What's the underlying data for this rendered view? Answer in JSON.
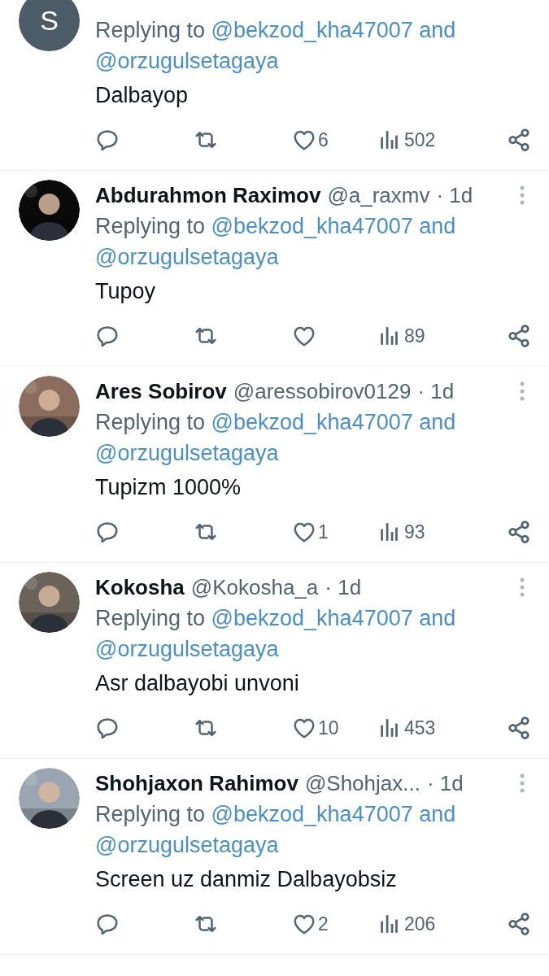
{
  "replies": [
    {
      "avatar": {
        "kind": "letter",
        "letter": "S"
      },
      "replying_label": "Replying to",
      "mentions": [
        "@bekzod_kha47007 and",
        "@orzugulsetagaya"
      ],
      "text": "Dalbayop",
      "actions": {
        "likes": "6",
        "views": "502"
      }
    },
    {
      "author": {
        "name": "Abdurahmon Raximov",
        "handle": "@a_raxmv",
        "time": "· 1d"
      },
      "replying_label": "Replying to",
      "mentions": [
        "@bekzod_kha47007 and",
        "@orzugulsetagaya"
      ],
      "text": "Tupoy",
      "actions": {
        "views": "89"
      }
    },
    {
      "author": {
        "name": "Ares Sobirov",
        "handle": "@aressobirov0129",
        "time": "· 1d"
      },
      "replying_label": "Replying to",
      "mentions": [
        "@bekzod_kha47007 and",
        "@orzugulsetagaya"
      ],
      "text": "Tupizm 1000%",
      "actions": {
        "likes": "1",
        "views": "93"
      }
    },
    {
      "author": {
        "name": "Kokosha",
        "handle": "@Kokosha_a",
        "time": "· 1d"
      },
      "replying_label": "Replying to",
      "mentions": [
        "@bekzod_kha47007 and",
        "@orzugulsetagaya"
      ],
      "text": "Asr dalbayobi unvoni",
      "actions": {
        "likes": "10",
        "views": "453"
      }
    },
    {
      "author": {
        "name": "Shohjaxon Rahimov",
        "handle": "@Shohjax...",
        "time": "· 1d"
      },
      "replying_label": "Replying to",
      "mentions": [
        "@bekzod_kha47007 and",
        "@orzugulsetagaya"
      ],
      "text": "Screen uz danmiz Dalbayobsiz",
      "actions": {
        "likes": "2",
        "views": "206"
      }
    }
  ]
}
